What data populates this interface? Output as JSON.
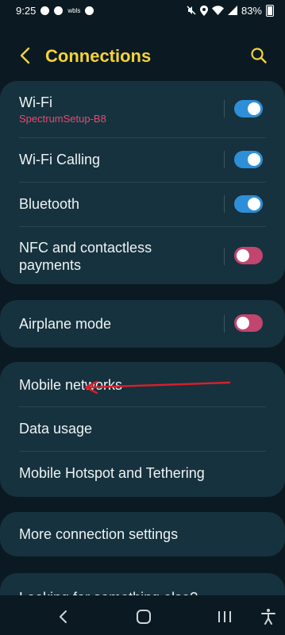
{
  "status_bar": {
    "time": "9:25",
    "wbls": "wbls",
    "battery": "83%"
  },
  "header": {
    "title": "Connections",
    "back_icon": "chevron-left-icon",
    "search_icon": "search-icon"
  },
  "group1": {
    "wifi": {
      "label": "Wi-Fi",
      "network": "SpectrumSetup-B8",
      "state": "on"
    },
    "wifi_calling": {
      "label": "Wi-Fi Calling",
      "state": "on"
    },
    "bluetooth": {
      "label": "Bluetooth",
      "state": "on"
    },
    "nfc": {
      "label_line1": "NFC and contactless",
      "label_line2": "payments",
      "state": "off"
    }
  },
  "group2": {
    "airplane": {
      "label": "Airplane mode",
      "state": "off"
    }
  },
  "group3": {
    "mobile_networks": "Mobile networks",
    "data_usage": "Data usage",
    "hotspot": "Mobile Hotspot and Tethering"
  },
  "group4": {
    "more_settings": "More connection settings"
  },
  "group5": {
    "looking": "Looking for something else?"
  },
  "annotation": {
    "arrow_color": "#d8202a"
  },
  "colors": {
    "accent_yellow": "#f5d23c",
    "toggle_on": "#2d8fd8",
    "toggle_off": "#c1456e",
    "ssid_pink": "#e64a72"
  },
  "nav": {
    "back": "back-icon",
    "home": "home-icon",
    "recents": "recents-icon",
    "accessibility": "accessibility-icon"
  }
}
